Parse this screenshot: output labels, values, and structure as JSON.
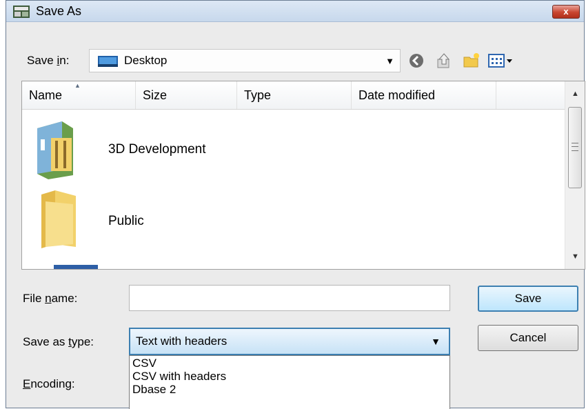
{
  "window": {
    "title": "Save As",
    "close_label": "x"
  },
  "save_in": {
    "label_pre": "Save ",
    "label_u": "i",
    "label_post": "n:",
    "value": "Desktop"
  },
  "toolbar": {
    "back": "back-icon",
    "up": "up-folder-icon",
    "new_folder": "new-folder-icon",
    "views": "views-menu-icon"
  },
  "file_list": {
    "columns": [
      "Name",
      "Size",
      "Type",
      "Date modified"
    ],
    "items": [
      {
        "label": "3D Development"
      },
      {
        "label": "Public"
      }
    ]
  },
  "file_name": {
    "label_pre": "File ",
    "label_u": "n",
    "label_post": "ame:",
    "value": ""
  },
  "save_as_type": {
    "label_pre": "Save as ",
    "label_u": "t",
    "label_post": "ype:",
    "value": "Text with headers",
    "options": [
      "CSV",
      "CSV with headers",
      "Dbase 2"
    ]
  },
  "encoding": {
    "label_u": "E",
    "label_post": "ncoding:"
  },
  "buttons": {
    "save": "Save",
    "cancel": "Cancel"
  },
  "colors": {
    "accent": "#3c7fb1",
    "close": "#c9452f",
    "folder": "#f2d16a"
  }
}
